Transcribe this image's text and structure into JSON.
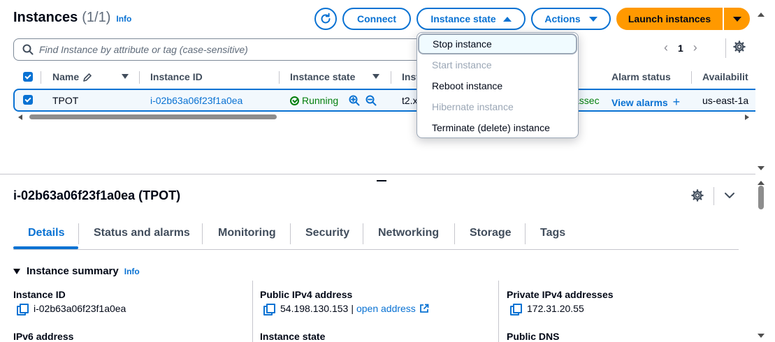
{
  "header": {
    "title": "Instances",
    "count": "(1/1)",
    "info": "Info",
    "connect_label": "Connect",
    "instance_state_label": "Instance state",
    "actions_label": "Actions",
    "launch_label": "Launch instances",
    "refresh_icon": "refresh-icon"
  },
  "search": {
    "placeholder": "Find Instance by attribute or tag (case-sensitive)"
  },
  "pagination": {
    "current_page": "1"
  },
  "table": {
    "columns": [
      "Name",
      "Instance ID",
      "Instance state",
      "Inst",
      "Alarm status",
      "Availabilit"
    ],
    "row": {
      "name": "TPOT",
      "instance_id": "i-02b63a06f23f1a0ea",
      "state": "Running",
      "type": "t2.x",
      "status_check": "assec",
      "alarm": "View alarms",
      "availability": "us-east-1a"
    }
  },
  "state_menu": {
    "items": [
      {
        "label": "Stop instance",
        "disabled": false
      },
      {
        "label": "Start instance",
        "disabled": true
      },
      {
        "label": "Reboot instance",
        "disabled": false
      },
      {
        "label": "Hibernate instance",
        "disabled": true
      },
      {
        "label": "Terminate (delete) instance",
        "disabled": false
      }
    ]
  },
  "detail": {
    "title": "i-02b63a06f23f1a0ea (TPOT)",
    "tabs": [
      "Details",
      "Status and alarms",
      "Monitoring",
      "Security",
      "Networking",
      "Storage",
      "Tags"
    ],
    "summary_title": "Instance summary",
    "summary_info": "Info",
    "fields": {
      "instance_id_label": "Instance ID",
      "instance_id_value": "i-02b63a06f23f1a0ea",
      "public_ipv4_label": "Public IPv4 address",
      "public_ipv4_value": "54.198.130.153",
      "open_address": "open address",
      "private_ipv4_label": "Private IPv4 addresses",
      "private_ipv4_value": "172.31.20.55",
      "ipv6_label": "IPv6 address",
      "instance_state_label": "Instance state",
      "public_dns_label": "Public DNS"
    }
  },
  "colors": {
    "primary": "#0972d3",
    "launch": "#ff9900",
    "running": "#037f0c",
    "text": "#000716"
  }
}
